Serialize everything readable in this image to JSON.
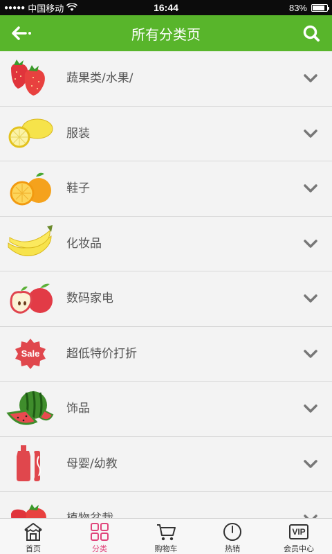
{
  "status_bar": {
    "carrier": "中国移动",
    "signal_dots": "●●●●●",
    "time": "16:44",
    "battery_percent": "83%",
    "battery_level": 0.83
  },
  "header": {
    "title": "所有分类页",
    "back_icon": "back-arrow-icon",
    "search_icon": "search-icon",
    "accent_color": "#58b52b"
  },
  "categories": [
    {
      "label": "蔬果类/水果/",
      "icon": "strawberry-icon"
    },
    {
      "label": "服装",
      "icon": "lemon-icon"
    },
    {
      "label": "鞋子",
      "icon": "orange-icon"
    },
    {
      "label": "化妆品",
      "icon": "banana-icon"
    },
    {
      "label": "数码家电",
      "icon": "apple-icon"
    },
    {
      "label": "超低特价打折",
      "icon": "sale-badge-icon"
    },
    {
      "label": "饰品",
      "icon": "watermelon-icon"
    },
    {
      "label": "母婴/幼教",
      "icon": "ketchup-icon"
    },
    {
      "label": "植物盆栽",
      "icon": "strawberry-icon"
    }
  ],
  "sale_badge_text": "Sale",
  "tabbar": {
    "active_color": "#e0457b",
    "tabs": [
      {
        "label": "首页",
        "icon": "home-icon"
      },
      {
        "label": "分类",
        "icon": "category-grid-icon"
      },
      {
        "label": "购物车",
        "icon": "cart-icon"
      },
      {
        "label": "热销",
        "icon": "clock-icon"
      },
      {
        "label": "会员中心",
        "icon": "vip-icon",
        "icon_text": "VIP"
      }
    ]
  }
}
